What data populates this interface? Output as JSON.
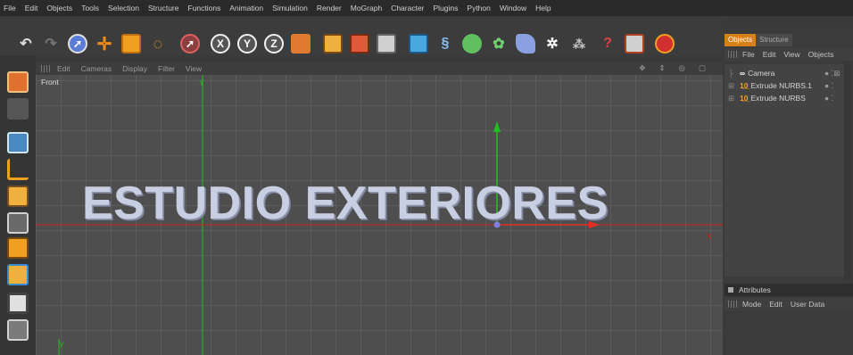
{
  "menu": [
    "File",
    "Edit",
    "Objects",
    "Tools",
    "Selection",
    "Structure",
    "Functions",
    "Animation",
    "Simulation",
    "Render",
    "MoGraph",
    "Character",
    "Plugins",
    "Python",
    "Window",
    "Help"
  ],
  "toolbar": {
    "icons": [
      "undo-icon",
      "redo-icon",
      "select-icon",
      "move-icon",
      "scale-icon",
      "rotate-icon",
      "live-select-icon",
      "x-axis-icon",
      "y-axis-icon",
      "z-axis-icon",
      "world-coordinates-icon",
      "render-view-icon",
      "render-picture-viewer-icon",
      "edit-render-settings-icon",
      "cube-icon",
      "spline-icon",
      "nurbs-icon",
      "array-icon",
      "deformer-icon",
      "scene-icon",
      "light-icon",
      "tags-icon",
      "material-icon",
      "help-icon"
    ],
    "axis_letters": [
      "X",
      "Y",
      "Z"
    ]
  },
  "viewport": {
    "menu": [
      "Edit",
      "Cameras",
      "Display",
      "Filter",
      "View"
    ],
    "label": "Front",
    "text": "ESTUDIO EXTERIORES",
    "axis_x": "X",
    "axis_y": "Y",
    "nav_icons": [
      "✥",
      "⇕",
      "◎",
      "▢"
    ]
  },
  "object_manager": {
    "tabs": [
      "Objects",
      "Structure"
    ],
    "menu": [
      "File",
      "Edit",
      "View",
      "Objects"
    ],
    "items": [
      {
        "name": "Camera",
        "icon": "camera-icon"
      },
      {
        "name": "Extrude NURBS.1",
        "icon": "extrude-icon"
      },
      {
        "name": "Extrude NURBS",
        "icon": "extrude-icon"
      }
    ]
  },
  "attributes": {
    "title": "Attributes",
    "menu": [
      "Mode",
      "Edit",
      "User Data"
    ]
  },
  "colors": {
    "accent": "#d6801a",
    "x_axis": "#d02020",
    "y_axis": "#20c020",
    "text_face": "#c9cfe3"
  }
}
